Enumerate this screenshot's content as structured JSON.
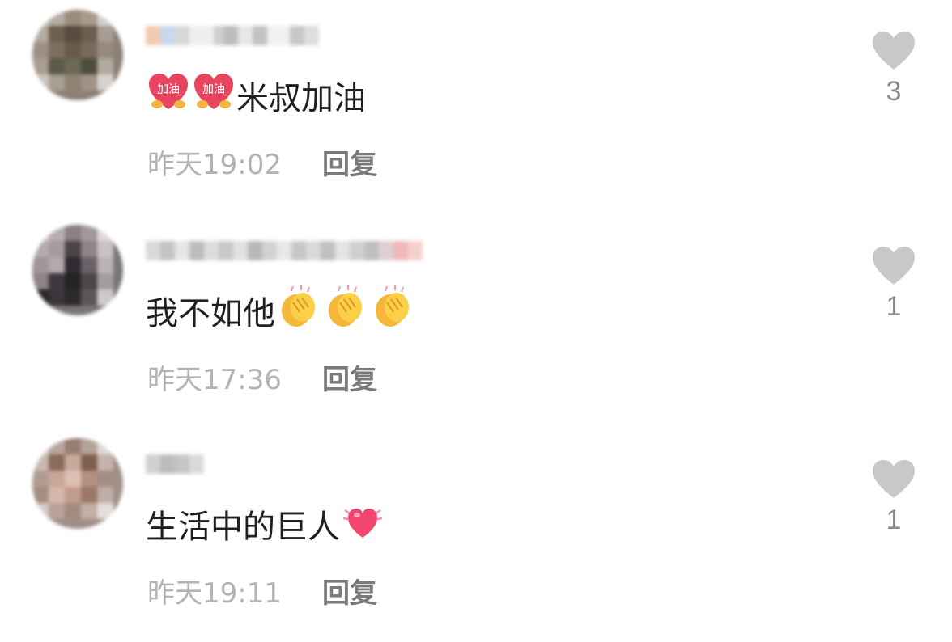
{
  "comments": [
    {
      "text": "米叔加油",
      "time": "昨天19:02",
      "reply_label": "回复",
      "likes": "3",
      "emoji": [
        "cheer-heart-emoji",
        "cheer-heart-emoji"
      ],
      "emoji_text": [
        "加油",
        "加油"
      ]
    },
    {
      "text": "我不如他",
      "time": "昨天17:36",
      "reply_label": "回复",
      "likes": "1",
      "emoji": [
        "clapping-hands-emoji",
        "clapping-hands-emoji",
        "clapping-hands-emoji"
      ]
    },
    {
      "text": "生活中的巨人",
      "time": "昨天19:11",
      "reply_label": "回复",
      "likes": "1",
      "emoji": [
        "sparkling-heart-emoji"
      ]
    }
  ],
  "colors": {
    "like_heart": "#c8c8c8",
    "time_text": "#b3b3b3",
    "reply_text": "#7a7a7a",
    "comment_text": "#1f1f1f"
  }
}
